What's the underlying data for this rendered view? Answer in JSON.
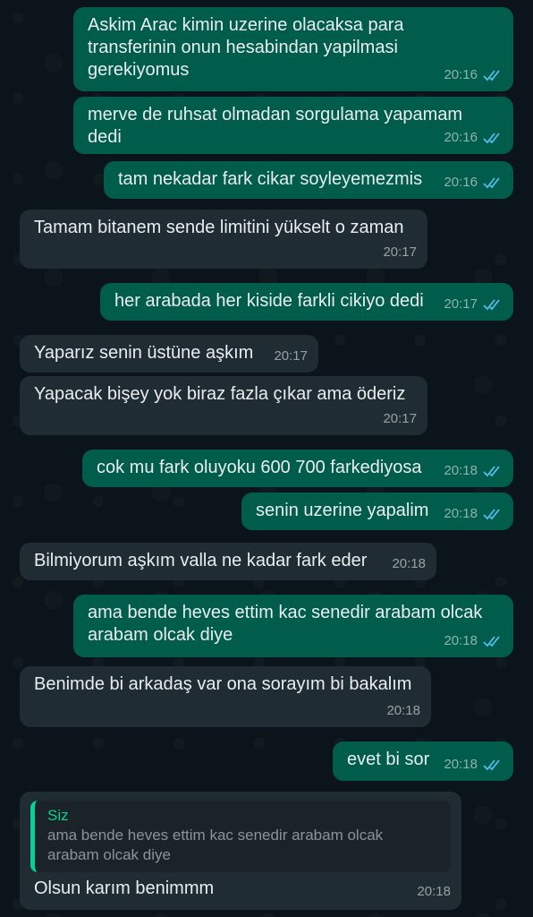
{
  "messages": [
    {
      "text": "Askim Arac kimin uzerine olacaksa para transferinin onun hesabindan yapilmasi gerekiyomus",
      "time": "20:16",
      "dir": "out",
      "read": true
    },
    {
      "text": "merve de ruhsat olmadan sorgulama yapamam dedi",
      "time": "20:16",
      "dir": "out",
      "read": true
    },
    {
      "text": "tam nekadar fark cikar soyleyemezmis",
      "time": "20:16",
      "dir": "out",
      "read": true
    },
    {
      "text": "Tamam bitanem sende limitini yükselt o zaman",
      "time": "20:17",
      "dir": "in"
    },
    {
      "text": "her arabada her kiside farkli cikiyo dedi",
      "time": "20:17",
      "dir": "out",
      "read": true
    },
    {
      "text": "Yaparız senin üstüne aşkım",
      "time": "20:17",
      "dir": "in"
    },
    {
      "text": "Yapacak bişey yok biraz fazla çıkar ama öderiz",
      "time": "20:17",
      "dir": "in"
    },
    {
      "text": "cok mu fark oluyoku 600 700 farkediyosa",
      "time": "20:18",
      "dir": "out",
      "read": true
    },
    {
      "text": "senin uzerine yapalim",
      "time": "20:18",
      "dir": "out",
      "read": true
    },
    {
      "text": "Bilmiyorum aşkım valla ne kadar fark eder",
      "time": "20:18",
      "dir": "in"
    },
    {
      "text": "ama bende heves ettim kac senedir arabam olcak arabam olcak diye",
      "time": "20:18",
      "dir": "out",
      "read": true
    },
    {
      "text": "Benimde bi arkadaş var ona sorayım bi bakalım",
      "time": "20:18",
      "dir": "in"
    },
    {
      "text": "evet bi sor",
      "time": "20:18",
      "dir": "out",
      "read": true
    }
  ],
  "reply": {
    "quote_author": "Siz",
    "quote_text": "ama bende heves ettim kac senedir arabam olcak arabam olcak diye",
    "text": "Olsun karım benimmm",
    "time": "20:18"
  },
  "colors": {
    "background": "#0b141a",
    "outgoing_bubble": "#005c4b",
    "incoming_bubble": "#202c33",
    "read_ticks": "#53bdeb",
    "quote_accent": "#06cf9c"
  }
}
